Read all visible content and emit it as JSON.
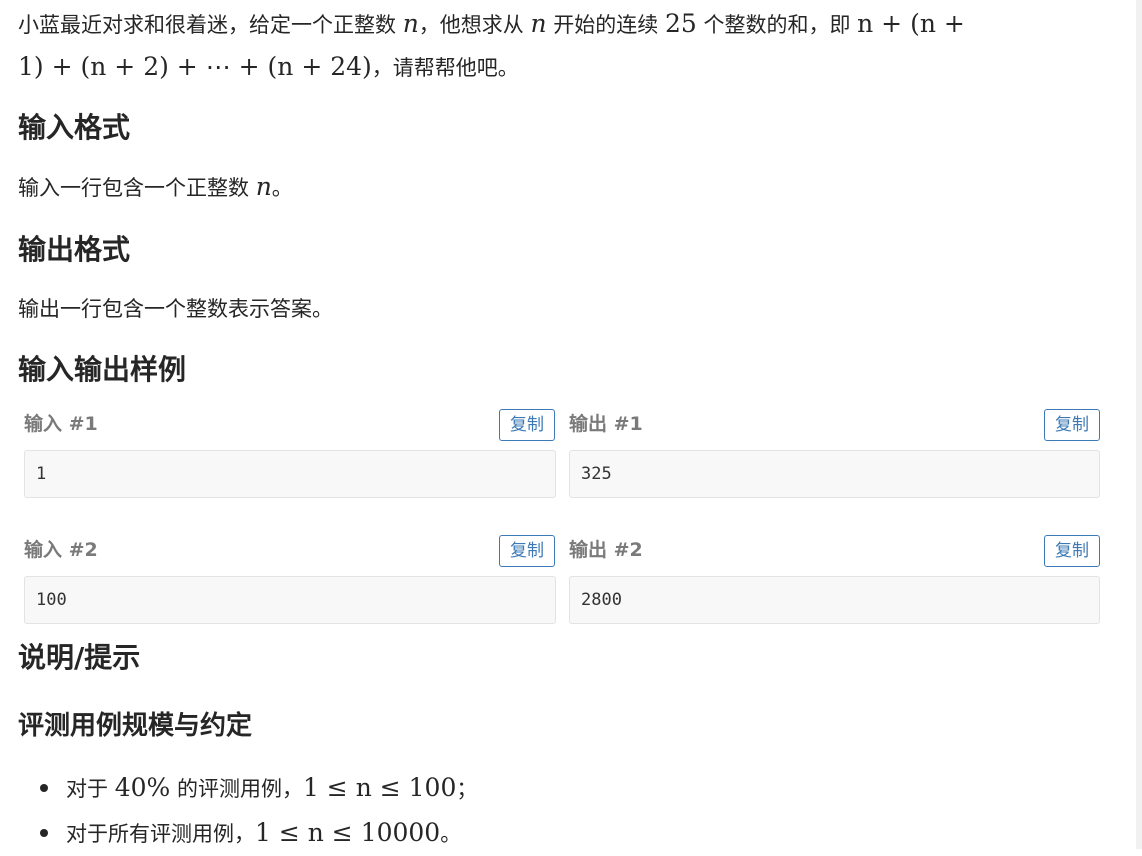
{
  "statement": {
    "line1": {
      "t1": "小蓝最近对求和很着迷，给定一个正整数 ",
      "var1": "n",
      "t2": "，他想求从 ",
      "var2": "n",
      "t3": " 开始的连续 ",
      "num1": "25",
      "t4": " 个整数的和，即 ",
      "expr1": "n + (n +"
    },
    "line2": {
      "expr2": "1) + (n + 2) + ⋯ + (n + 24)",
      "t5": "，请帮帮他吧。"
    }
  },
  "input_format": {
    "heading": "输入格式",
    "text1": "输入一行包含一个正整数 ",
    "var": "n",
    "text2": "。"
  },
  "output_format": {
    "heading": "输出格式",
    "text": "输出一行包含一个整数表示答案。"
  },
  "samples": {
    "heading": "输入输出样例",
    "copy_label": "复制",
    "items": [
      {
        "input_label": "输入 #1",
        "output_label": "输出 #1",
        "input": "1",
        "output": "325"
      },
      {
        "input_label": "输入 #2",
        "output_label": "输出 #2",
        "input": "100",
        "output": "2800"
      }
    ]
  },
  "hint": {
    "heading": "说明/提示",
    "subheading": "评测用例规模与约定",
    "bullets": [
      {
        "pre": "对于 ",
        "math1": "40%",
        "mid": " 的评测用例，",
        "math2": "1 ≤ n ≤ 100",
        "post": "；"
      },
      {
        "pre": "对于所有评测用例，",
        "math2": "1 ≤ n ≤ 10000",
        "post": "。"
      }
    ]
  },
  "colors": {
    "accent": "#3d7ab5",
    "label_gray": "#7a7a7a",
    "box_bg": "#f8f8f8",
    "text": "#262626"
  }
}
